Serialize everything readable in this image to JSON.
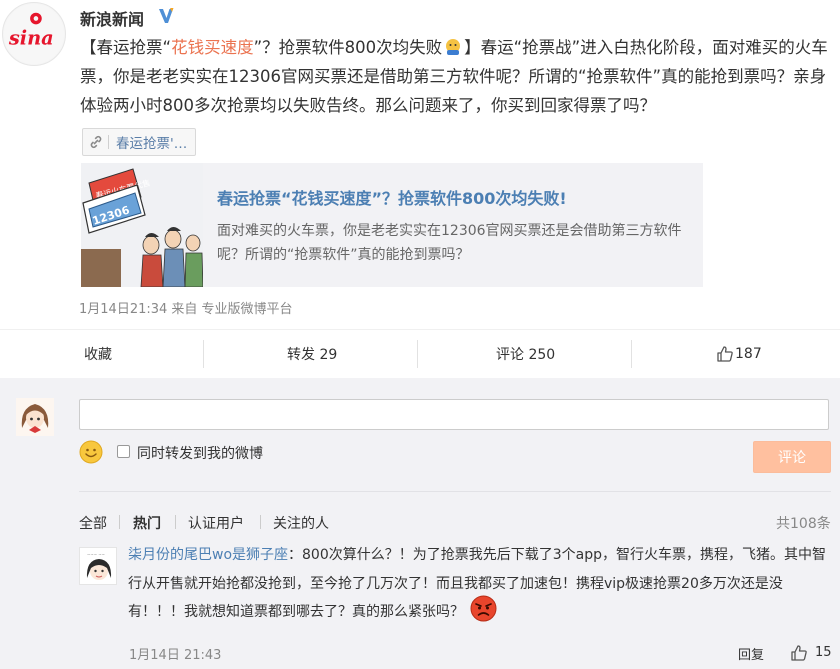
{
  "post": {
    "author": "新浪新闻",
    "logo_text": "sina",
    "text_open": "【春运抢票“",
    "text_highlight": "花钱买速度",
    "text_mid": "”？抢票软件800次均失败",
    "text_rest": "】春运“抢票战”进入白热化阶段，面对难买的火车票，你是老老实实在12306官网买票还是借助第三方软件呢？所谓的“抢票软件”真的能抢到票吗？亲身体验两小时800多次抢票均以失败告终。那么问题来了，你买到回家得票了吗？",
    "topic_tag": "春运抢票'…",
    "card": {
      "image_caption": "12306",
      "image_sign": "春运火车票代售",
      "title": "春运抢票“花钱买速度”？抢票软件800次均失败!",
      "desc": "面对难买的火车票，你是老老实实在12306官网买票还是会借助第三方软件呢？所谓的“抢票软件”真的能抢到票吗？"
    },
    "meta": "1月14日21:34 来自 专业版微博平台"
  },
  "actions": {
    "collect": "收藏",
    "repost": "转发 29",
    "comment": "评论 250",
    "like_count": "187"
  },
  "comment_form": {
    "input_value": "",
    "repost_label": "同时转发到我的微博",
    "submit_label": "评论"
  },
  "filters": {
    "all": "全部",
    "hot": "热门",
    "verified": "认证用户",
    "following": "关注的人",
    "total": "共108条"
  },
  "comment": {
    "user": "柒月份的尾巴wo是狮子座",
    "text": "：800次算什么？！为了抢票我先后下载了3个app，智行火车票，携程，飞猪。其中智行从开售就开始抢都没抢到，至今抢了几万次了！而且我都买了加速包！携程vip极速抢票20多万次还是没有！！！我就想知道票都到哪去了？真的那么紧张吗？",
    "time": "1月14日 21:43",
    "reply": "回复",
    "likes": "15"
  },
  "colors": {
    "highlight": "#eb7350",
    "link": "#4c7fb3",
    "submit_bg": "#ffc09f",
    "comment_bg": "#f2f2f5"
  },
  "icons": [
    "sina-logo-icon",
    "verified-icon",
    "link-icon",
    "thumb-up-icon",
    "smile-icon",
    "angry-emoji-icon"
  ]
}
